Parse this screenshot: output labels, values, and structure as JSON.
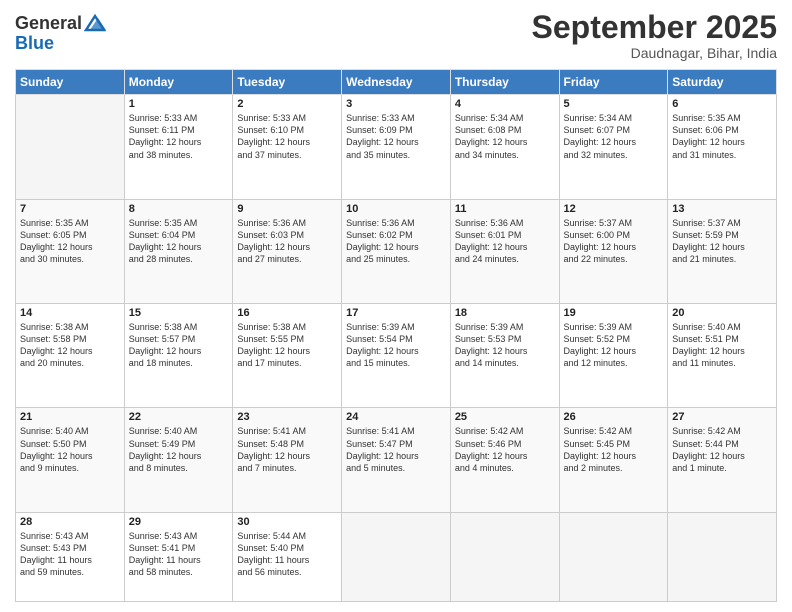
{
  "header": {
    "logo_general": "General",
    "logo_blue": "Blue",
    "month_title": "September 2025",
    "location": "Daudnagar, Bihar, India"
  },
  "weekdays": [
    "Sunday",
    "Monday",
    "Tuesday",
    "Wednesday",
    "Thursday",
    "Friday",
    "Saturday"
  ],
  "weeks": [
    [
      {
        "day": "",
        "info": ""
      },
      {
        "day": "1",
        "info": "Sunrise: 5:33 AM\nSunset: 6:11 PM\nDaylight: 12 hours\nand 38 minutes."
      },
      {
        "day": "2",
        "info": "Sunrise: 5:33 AM\nSunset: 6:10 PM\nDaylight: 12 hours\nand 37 minutes."
      },
      {
        "day": "3",
        "info": "Sunrise: 5:33 AM\nSunset: 6:09 PM\nDaylight: 12 hours\nand 35 minutes."
      },
      {
        "day": "4",
        "info": "Sunrise: 5:34 AM\nSunset: 6:08 PM\nDaylight: 12 hours\nand 34 minutes."
      },
      {
        "day": "5",
        "info": "Sunrise: 5:34 AM\nSunset: 6:07 PM\nDaylight: 12 hours\nand 32 minutes."
      },
      {
        "day": "6",
        "info": "Sunrise: 5:35 AM\nSunset: 6:06 PM\nDaylight: 12 hours\nand 31 minutes."
      }
    ],
    [
      {
        "day": "7",
        "info": "Sunrise: 5:35 AM\nSunset: 6:05 PM\nDaylight: 12 hours\nand 30 minutes."
      },
      {
        "day": "8",
        "info": "Sunrise: 5:35 AM\nSunset: 6:04 PM\nDaylight: 12 hours\nand 28 minutes."
      },
      {
        "day": "9",
        "info": "Sunrise: 5:36 AM\nSunset: 6:03 PM\nDaylight: 12 hours\nand 27 minutes."
      },
      {
        "day": "10",
        "info": "Sunrise: 5:36 AM\nSunset: 6:02 PM\nDaylight: 12 hours\nand 25 minutes."
      },
      {
        "day": "11",
        "info": "Sunrise: 5:36 AM\nSunset: 6:01 PM\nDaylight: 12 hours\nand 24 minutes."
      },
      {
        "day": "12",
        "info": "Sunrise: 5:37 AM\nSunset: 6:00 PM\nDaylight: 12 hours\nand 22 minutes."
      },
      {
        "day": "13",
        "info": "Sunrise: 5:37 AM\nSunset: 5:59 PM\nDaylight: 12 hours\nand 21 minutes."
      }
    ],
    [
      {
        "day": "14",
        "info": "Sunrise: 5:38 AM\nSunset: 5:58 PM\nDaylight: 12 hours\nand 20 minutes."
      },
      {
        "day": "15",
        "info": "Sunrise: 5:38 AM\nSunset: 5:57 PM\nDaylight: 12 hours\nand 18 minutes."
      },
      {
        "day": "16",
        "info": "Sunrise: 5:38 AM\nSunset: 5:55 PM\nDaylight: 12 hours\nand 17 minutes."
      },
      {
        "day": "17",
        "info": "Sunrise: 5:39 AM\nSunset: 5:54 PM\nDaylight: 12 hours\nand 15 minutes."
      },
      {
        "day": "18",
        "info": "Sunrise: 5:39 AM\nSunset: 5:53 PM\nDaylight: 12 hours\nand 14 minutes."
      },
      {
        "day": "19",
        "info": "Sunrise: 5:39 AM\nSunset: 5:52 PM\nDaylight: 12 hours\nand 12 minutes."
      },
      {
        "day": "20",
        "info": "Sunrise: 5:40 AM\nSunset: 5:51 PM\nDaylight: 12 hours\nand 11 minutes."
      }
    ],
    [
      {
        "day": "21",
        "info": "Sunrise: 5:40 AM\nSunset: 5:50 PM\nDaylight: 12 hours\nand 9 minutes."
      },
      {
        "day": "22",
        "info": "Sunrise: 5:40 AM\nSunset: 5:49 PM\nDaylight: 12 hours\nand 8 minutes."
      },
      {
        "day": "23",
        "info": "Sunrise: 5:41 AM\nSunset: 5:48 PM\nDaylight: 12 hours\nand 7 minutes."
      },
      {
        "day": "24",
        "info": "Sunrise: 5:41 AM\nSunset: 5:47 PM\nDaylight: 12 hours\nand 5 minutes."
      },
      {
        "day": "25",
        "info": "Sunrise: 5:42 AM\nSunset: 5:46 PM\nDaylight: 12 hours\nand 4 minutes."
      },
      {
        "day": "26",
        "info": "Sunrise: 5:42 AM\nSunset: 5:45 PM\nDaylight: 12 hours\nand 2 minutes."
      },
      {
        "day": "27",
        "info": "Sunrise: 5:42 AM\nSunset: 5:44 PM\nDaylight: 12 hours\nand 1 minute."
      }
    ],
    [
      {
        "day": "28",
        "info": "Sunrise: 5:43 AM\nSunset: 5:43 PM\nDaylight: 11 hours\nand 59 minutes."
      },
      {
        "day": "29",
        "info": "Sunrise: 5:43 AM\nSunset: 5:41 PM\nDaylight: 11 hours\nand 58 minutes."
      },
      {
        "day": "30",
        "info": "Sunrise: 5:44 AM\nSunset: 5:40 PM\nDaylight: 11 hours\nand 56 minutes."
      },
      {
        "day": "",
        "info": ""
      },
      {
        "day": "",
        "info": ""
      },
      {
        "day": "",
        "info": ""
      },
      {
        "day": "",
        "info": ""
      }
    ]
  ]
}
